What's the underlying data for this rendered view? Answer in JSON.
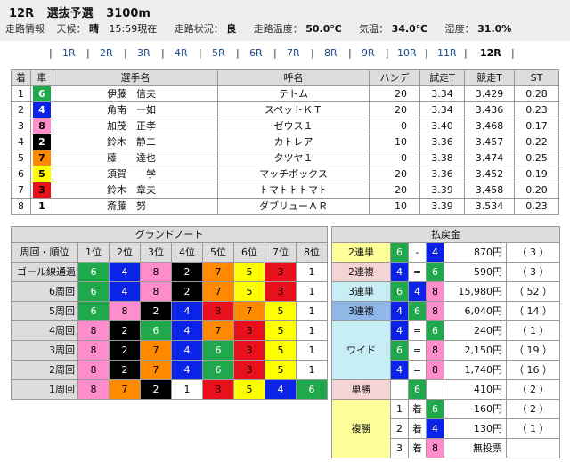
{
  "header": {
    "race": "12R",
    "race_name": "選抜予選",
    "distance": "3100m",
    "info_label": "走路情報",
    "weather_label": "天候：",
    "weather": "晴",
    "time": "15:59現在",
    "track_label": "走路状況：",
    "track": "良",
    "track_temp_label": "走路温度：",
    "track_temp": "50.0℃",
    "air_temp_label": "気温：",
    "air_temp": "34.0℃",
    "humidity_label": "湿度：",
    "humidity": "31.0%"
  },
  "tabs": [
    "1R",
    "2R",
    "3R",
    "4R",
    "5R",
    "6R",
    "7R",
    "8R",
    "9R",
    "10R",
    "11R",
    "12R"
  ],
  "active_tab": "12R",
  "entries": {
    "headers": [
      "着",
      "車",
      "選手名",
      "呼名",
      "ハンデ",
      "試走T",
      "競走T",
      "ST"
    ],
    "rows": [
      {
        "pos": "1",
        "car": "6",
        "name": "伊藤　信夫",
        "nick": "テトム",
        "hande": "20",
        "trial": "3.34",
        "race": "3.429",
        "st": "0.28"
      },
      {
        "pos": "2",
        "car": "4",
        "name": "角南　一如",
        "nick": "スペットＫＴ",
        "hande": "20",
        "trial": "3.34",
        "race": "3.436",
        "st": "0.23"
      },
      {
        "pos": "3",
        "car": "8",
        "name": "加茂　正孝",
        "nick": "ゼウス１",
        "hande": "0",
        "trial": "3.40",
        "race": "3.468",
        "st": "0.17"
      },
      {
        "pos": "4",
        "car": "2",
        "name": "鈴木　静二",
        "nick": "カトレア",
        "hande": "10",
        "trial": "3.36",
        "race": "3.457",
        "st": "0.22"
      },
      {
        "pos": "5",
        "car": "7",
        "name": "藤　　達也",
        "nick": "タツヤ１",
        "hande": "0",
        "trial": "3.38",
        "race": "3.474",
        "st": "0.25"
      },
      {
        "pos": "6",
        "car": "5",
        "name": "須賀　　学",
        "nick": "マッチボックス",
        "hande": "20",
        "trial": "3.36",
        "race": "3.452",
        "st": "0.19"
      },
      {
        "pos": "7",
        "car": "3",
        "name": "鈴木　章夫",
        "nick": "トマトトトマト",
        "hande": "20",
        "trial": "3.39",
        "race": "3.458",
        "st": "0.20"
      },
      {
        "pos": "8",
        "car": "1",
        "name": "斎藤　努",
        "nick": "ダブリューＡＲ",
        "hande": "10",
        "trial": "3.39",
        "race": "3.534",
        "st": "0.23"
      }
    ]
  },
  "grand_note": {
    "title": "グランドノート",
    "headers": [
      "周回・順位",
      "1位",
      "2位",
      "3位",
      "4位",
      "5位",
      "6位",
      "7位",
      "8位"
    ],
    "rows": [
      {
        "label": "ゴール線通過",
        "cars": [
          "6",
          "4",
          "8",
          "2",
          "7",
          "5",
          "3",
          "1"
        ]
      },
      {
        "label": "6周回",
        "cars": [
          "6",
          "4",
          "8",
          "2",
          "7",
          "5",
          "3",
          "1"
        ]
      },
      {
        "label": "5周回",
        "cars": [
          "6",
          "8",
          "2",
          "4",
          "3",
          "7",
          "5",
          "1"
        ]
      },
      {
        "label": "4周回",
        "cars": [
          "8",
          "2",
          "6",
          "4",
          "7",
          "3",
          "5",
          "1"
        ]
      },
      {
        "label": "3周回",
        "cars": [
          "8",
          "2",
          "7",
          "4",
          "6",
          "3",
          "5",
          "1"
        ]
      },
      {
        "label": "2周回",
        "cars": [
          "8",
          "2",
          "7",
          "4",
          "6",
          "3",
          "5",
          "1"
        ]
      },
      {
        "label": "1周回",
        "cars": [
          "8",
          "7",
          "2",
          "1",
          "3",
          "5",
          "4",
          "6"
        ]
      }
    ]
  },
  "payout": {
    "title": "払戻金",
    "rows": [
      {
        "type": "2連単",
        "a": "6",
        "sep": "-",
        "b": "4",
        "amount": "870円",
        "pop": "（ 3 ）"
      },
      {
        "type": "2連複",
        "a": "4",
        "sep": "=",
        "b": "6",
        "amount": "590円",
        "pop": "（ 3 ）"
      },
      {
        "type": "3連単",
        "a": "6",
        "b": "4",
        "c": "8",
        "amount": "15,980円",
        "pop": "（ 52 ）"
      },
      {
        "type": "3連複",
        "a": "4",
        "b": "6",
        "c": "8",
        "amount": "6,040円",
        "pop": "（ 14 ）"
      },
      {
        "type": "ワイド",
        "a": "4",
        "sep": "=",
        "b": "6",
        "amount": "240円",
        "pop": "（ 1 ）"
      },
      {
        "type": "ワイド",
        "a": "6",
        "sep": "=",
        "b": "8",
        "amount": "2,150円",
        "pop": "（ 19 ）"
      },
      {
        "type": "ワイド",
        "a": "4",
        "sep": "=",
        "b": "8",
        "amount": "1,740円",
        "pop": "（ 16 ）"
      },
      {
        "type": "単勝",
        "a": "6",
        "amount": "410円",
        "pop": "（ 2 ）"
      },
      {
        "type": "複勝",
        "rank": "1",
        "chaku": "着",
        "a": "6",
        "amount": "160円",
        "pop": "（ 2 ）"
      },
      {
        "type": "複勝",
        "rank": "2",
        "chaku": "着",
        "a": "4",
        "amount": "130円",
        "pop": "（ 1 ）"
      },
      {
        "type": "複勝",
        "rank": "3",
        "chaku": "着",
        "a": "8",
        "amount": "無投票",
        "pop": ""
      }
    ]
  }
}
